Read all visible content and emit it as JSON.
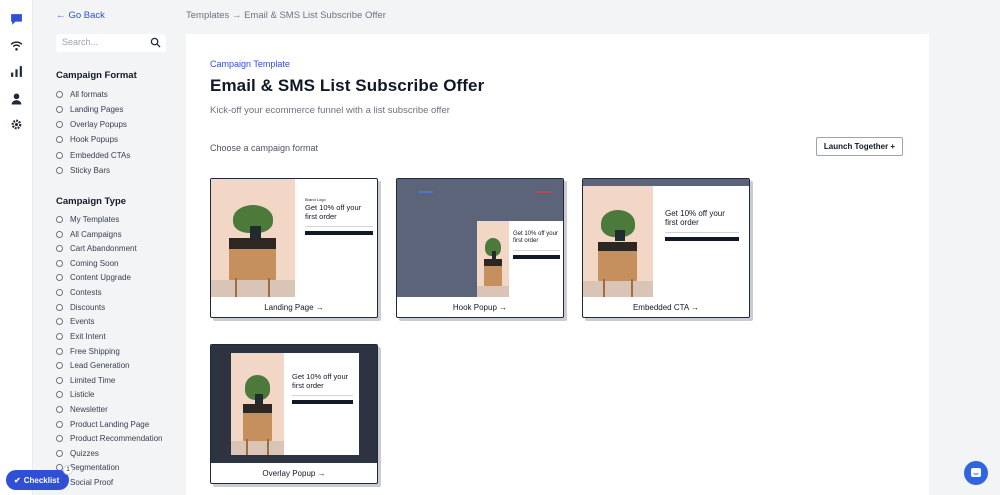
{
  "nav": {
    "go_back": "Go Back",
    "breadcrumb": "Templates → Email & SMS List Subscribe Offer"
  },
  "search": {
    "placeholder": "Search..."
  },
  "filters": {
    "format_title": "Campaign Format",
    "formats": [
      "All formats",
      "Landing Pages",
      "Overlay Popups",
      "Hook Popups",
      "Embedded CTAs",
      "Sticky Bars"
    ],
    "type_title": "Campaign Type",
    "types": [
      "My Templates",
      "All Campaigns",
      "Cart Abandonment",
      "Coming Soon",
      "Content Upgrade",
      "Contests",
      "Discounts",
      "Events",
      "Exit Intent",
      "Free Shipping",
      "Lead Generation",
      "Limited Time",
      "Listicle",
      "Newsletter",
      "Product Landing Page",
      "Product Recommendation",
      "Quizzes",
      "Segmentation",
      "Social Proof"
    ]
  },
  "main": {
    "eyebrow": "Campaign Template",
    "title": "Email & SMS List Subscribe Offer",
    "subtitle": "Kick-off your ecommerce funnel with a list subscribe offer",
    "choose_label": "Choose a campaign format",
    "launch_button": "Launch Together +"
  },
  "cards": [
    {
      "caption": "Landing Page →",
      "headline": "Get 10% off your first order",
      "brand": "Brand Logo"
    },
    {
      "caption": "Hook Popup →",
      "headline": "Get 10% off your first order"
    },
    {
      "caption": "Embedded CTA →",
      "headline": "Get 10% off your first order"
    },
    {
      "caption": "Overlay Popup →",
      "headline": "Get 10% off your first order"
    }
  ],
  "checklist": {
    "label": "Checklist",
    "count": "1"
  },
  "colors": {
    "accent": "#2f4fd6",
    "help": "#2f66e0",
    "overlay_dark": "#2d3340",
    "hook_bg": "#5b6478"
  }
}
